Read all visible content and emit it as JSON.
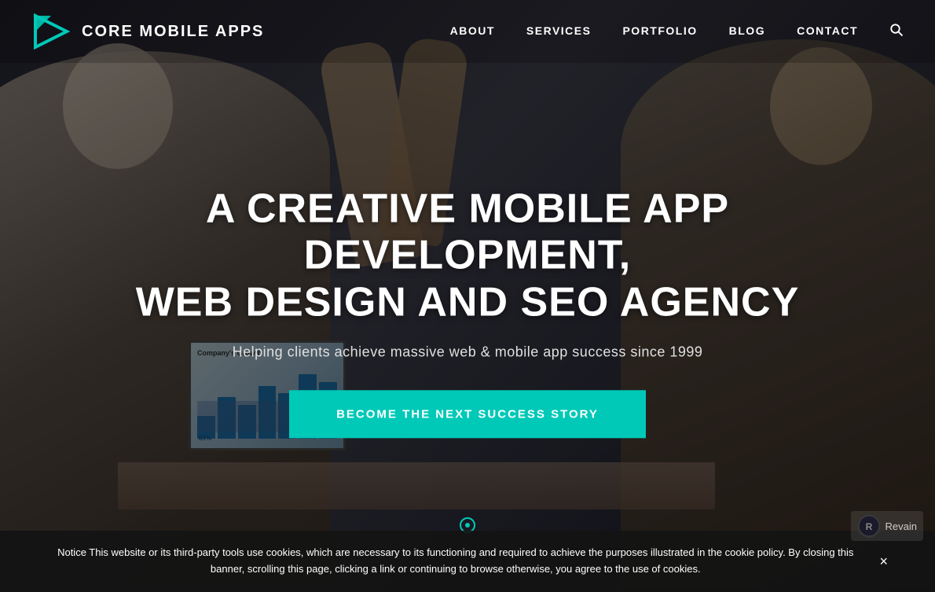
{
  "brand": {
    "name": "CORE MOBILE APPS",
    "logo_alt": "Core Mobile Apps Logo"
  },
  "nav": {
    "items": [
      {
        "label": "ABOUT",
        "href": "#about"
      },
      {
        "label": "SERVICES",
        "href": "#services"
      },
      {
        "label": "PORTFOLIO",
        "href": "#portfolio"
      },
      {
        "label": "BLOG",
        "href": "#blog"
      },
      {
        "label": "CONTACT",
        "href": "#contact"
      }
    ]
  },
  "hero": {
    "heading_line1": "A CREATIVE MOBILE APP DEVELOPMENT,",
    "heading_line2": "WEB DESIGN AND SEO AGENCY",
    "subheading": "Helping clients achieve massive web & mobile app success since 1999",
    "cta_label": "BECOME THE NEXT SUCCESS STORY"
  },
  "laptop": {
    "title": "Company's Growth"
  },
  "cookie": {
    "text": "Notice This website or its third-party tools use cookies, which are necessary to its functioning and required to achieve the purposes illustrated in the cookie policy. By closing this banner, scrolling this page, clicking a link or continuing to browse otherwise, you agree to the use of cookies.",
    "close_label": "×"
  },
  "revain": {
    "label": "Revain"
  },
  "colors": {
    "teal": "#00c9b7",
    "dark_overlay": "rgba(0,0,0,0.55)",
    "nav_bg": "rgba(0,0,0,0.2)",
    "cookie_bg": "rgba(20,20,20,0.92)"
  },
  "icons": {
    "search": "🔍",
    "close": "✕",
    "revain_icon": "R"
  }
}
